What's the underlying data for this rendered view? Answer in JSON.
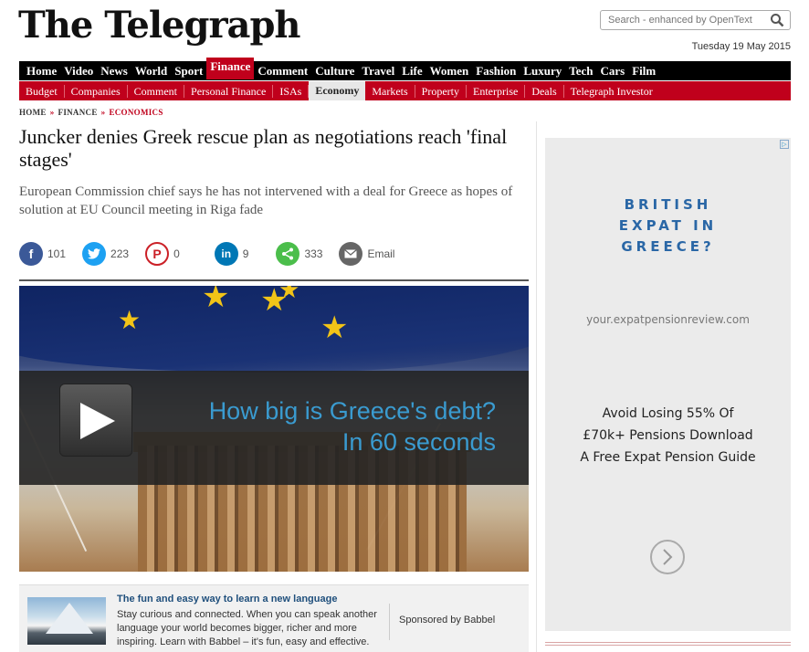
{
  "masthead": {
    "logo": "The Telegraph",
    "search_placeholder": "Search - enhanced by OpenText",
    "date": "Tuesday 19 May 2015"
  },
  "nav_primary": [
    "Home",
    "Video",
    "News",
    "World",
    "Sport",
    "Finance",
    "Comment",
    "Culture",
    "Travel",
    "Life",
    "Women",
    "Fashion",
    "Luxury",
    "Tech",
    "Cars",
    "Film"
  ],
  "nav_primary_active": "Finance",
  "nav_secondary": [
    "Budget",
    "Companies",
    "Comment",
    "Personal Finance",
    "ISAs",
    "Economy",
    "Markets",
    "Property",
    "Enterprise",
    "Deals",
    "Telegraph Investor"
  ],
  "nav_secondary_active": "Economy",
  "breadcrumb": {
    "home": "HOME",
    "section": "FINANCE",
    "current": "ECONOMICS",
    "sep": "»"
  },
  "article": {
    "headline": "Juncker denies Greek rescue plan as negotiations reach 'final stages'",
    "standfirst": "European Commission chief says he has not intervened with a deal for Greece as hopes of solution at EU Council meeting in Riga fade"
  },
  "share": {
    "facebook": "101",
    "twitter": "223",
    "pinterest": "0",
    "linkedin": "9",
    "sharethis": "333",
    "email": "Email",
    "colors": {
      "facebook": "#3b5998",
      "twitter": "#1da1f2",
      "pinterest": "#cb2027",
      "linkedin": "#0077b5",
      "sharethis": "#4bbe4b",
      "email": "#666666"
    }
  },
  "video": {
    "caption_line1": "How big is Greece's debt?",
    "caption_line2": "In 60 seconds",
    "caption_color": "#3a9bd0"
  },
  "promo": {
    "title": "The fun and easy way to learn a new language",
    "body": "Stay curious and connected. When you can speak another language your world becomes bigger, richer and more inspiring. Learn with Babbel – it's fun, easy and effective.",
    "sponsor": "Sponsored by Babbel"
  },
  "ad": {
    "headline_l1": "BRITISH",
    "headline_l2": "EXPAT IN",
    "headline_l3": "GREECE?",
    "url": "your.expatpensionreview.com",
    "body_l1": "Avoid Losing 55% Of",
    "body_l2": "£70k+ Pensions Download",
    "body_l3": "A Free Expat Pension Guide"
  }
}
